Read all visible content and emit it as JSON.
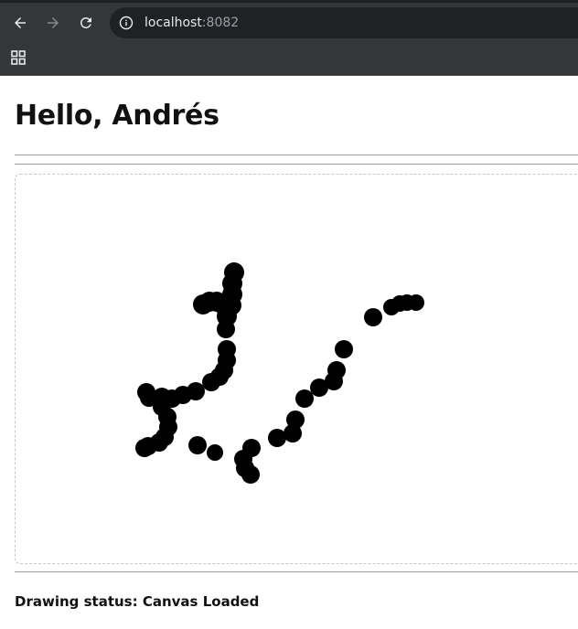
{
  "browser": {
    "url_host": "localhost",
    "url_port": ":8082"
  },
  "page": {
    "greeting": "Hello, Andrés",
    "status_label": "Drawing status:",
    "status_value": "Canvas Loaded"
  },
  "colors": {
    "ink": "#000000",
    "chrome_bg": "#35363a",
    "omnibox_bg": "#202124"
  }
}
